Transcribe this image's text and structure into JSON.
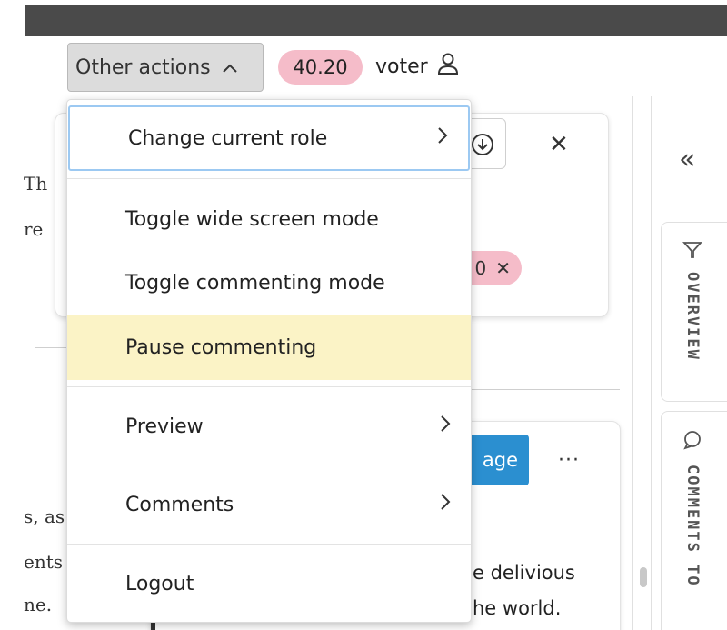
{
  "toolbar": {
    "other_actions_label": "Other actions",
    "score": "40.20",
    "role": "voter"
  },
  "menu": {
    "items": [
      {
        "label": "Change current role",
        "has_submenu": true,
        "state": "focused"
      },
      {
        "label": "Toggle wide screen mode",
        "has_submenu": false
      },
      {
        "label": "Toggle commenting mode",
        "has_submenu": false
      },
      {
        "label": "Pause commenting",
        "has_submenu": false,
        "state": "highlighted"
      },
      {
        "label": "Preview",
        "has_submenu": true
      },
      {
        "label": "Comments",
        "has_submenu": true
      },
      {
        "label": "Logout",
        "has_submenu": false
      }
    ]
  },
  "background": {
    "left_fragments": [
      "Th",
      "re",
      "s, as",
      "ents",
      "ne."
    ],
    "pink_tag_fragment": "0",
    "blue_button_fragment": "age",
    "more_label": "···",
    "text_fragments": [
      "e delivious",
      "he world."
    ]
  },
  "sidebar": {
    "collapse_label": "«",
    "overview_label": "OVERVIEW",
    "comments_label": "COMMENTS TO"
  },
  "colors": {
    "score_badge": "#f5bcc9",
    "menu_highlight": "#fbf3c6",
    "focus_ring": "#9cc9f2",
    "primary_button": "#2b8fd0"
  }
}
